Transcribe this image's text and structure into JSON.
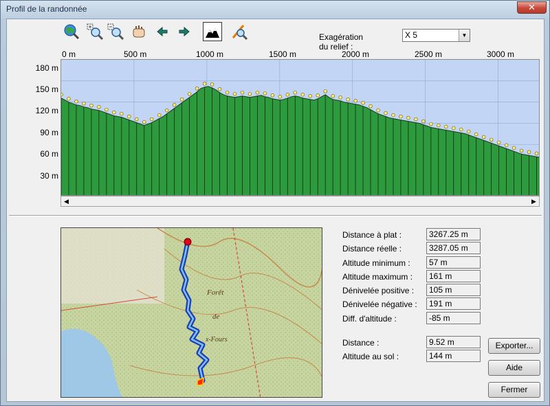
{
  "window": {
    "title": "Profil de la randonnée",
    "close_glyph": "✕"
  },
  "toolbar": {
    "icons": [
      "globe-search-icon",
      "zoom-in-icon",
      "zoom-out-icon",
      "pan-hand-icon",
      "arrow-left-icon",
      "arrow-right-icon",
      "terrain-view-icon",
      "measure-icon"
    ],
    "relief_label": "Exagération du relief :",
    "relief_value": "X 5"
  },
  "profile": {
    "x_ticks": [
      "0 m",
      "500 m",
      "1000 m",
      "1500 m",
      "2000 m",
      "2500 m",
      "3000 m"
    ],
    "y_ticks": [
      "180 m",
      "150 m",
      "120 m",
      "90 m",
      "60 m",
      "30 m"
    ],
    "fill_color": "#2e9a3e",
    "sky_color": "#c3d5f4"
  },
  "stats": [
    {
      "label": "Distance à plat :",
      "value": "3267.25 m"
    },
    {
      "label": "Distance réelle :",
      "value": "3287.05 m"
    },
    {
      "label": "Altitude minimum :",
      "value": "57 m"
    },
    {
      "label": "Altitude maximum :",
      "value": "161 m"
    },
    {
      "label": "Dénivelée positive :",
      "value": "105 m"
    },
    {
      "label": "Dénivelée négative :",
      "value": "191 m"
    },
    {
      "label": "Diff. d'altitude :",
      "value": "-85 m"
    }
  ],
  "cursor": [
    {
      "label": "Distance :",
      "value": "9.52 m"
    },
    {
      "label": "Altitude au sol :",
      "value": "144 m"
    }
  ],
  "buttons": {
    "export": "Exporter...",
    "help": "Aide",
    "close": "Fermer"
  },
  "map_labels": {
    "forest": "Forêt",
    "de": "de",
    "place": "x-Fours"
  }
}
